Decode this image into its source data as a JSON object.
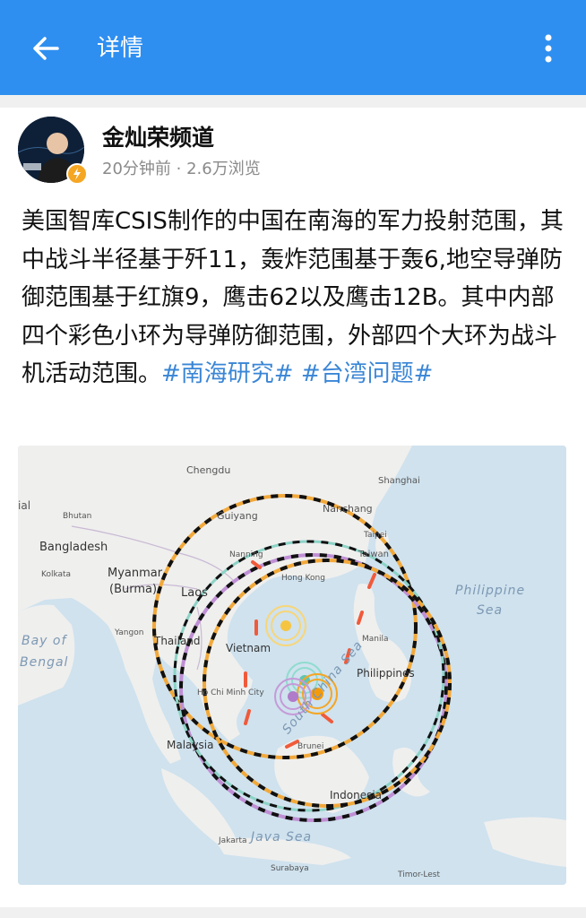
{
  "header": {
    "title": "详情",
    "icons": [
      "arrow-left-icon",
      "more-vertical-icon"
    ]
  },
  "author": {
    "name": "金灿荣频道",
    "time": "20分钟前",
    "views": "2.6万浏览",
    "meta": "20分钟前 · 2.6万浏览"
  },
  "post": {
    "text": "美国智库CSIS制作的中国在南海的军力投射范围，其中战斗半径基于歼11，轰炸范围基于轰6,地空导弹防御范围基于红旗9，鹰击62以及鹰击12B。其中内部四个彩色小环为导弹防御范围，外部四个大环为战斗机活动范围。",
    "tags": [
      "#南海研究#",
      "#台湾问题#"
    ]
  },
  "map": {
    "labels": {
      "chengdu": "Chengdu",
      "guiyang": "Guiyang",
      "nanchang": "Nanchang",
      "shanghai": "Shanghai",
      "bhutan": "Bhutan",
      "bangladesh": "Bangladesh",
      "kolkata": "Kolkata",
      "myanmar1": "Myanmar",
      "myanmar2": "(Burma)",
      "laos": "Laos",
      "nanning": "Nanning",
      "hongkong": "Hong Kong",
      "taipei": "Taipei",
      "taiwan": "Taiwan",
      "yangon": "Yangon",
      "thailand": "Thailand",
      "vietnam": "Vietnam",
      "bay1": "Bay of",
      "bay2": "Bengal",
      "hcmc": "Ho Chi Minh City",
      "manila": "Manila",
      "philippines": "Philippines",
      "philsea1": "Philippine",
      "philsea2": "Sea",
      "southchinasea": "South China Sea",
      "brunei": "Brunei",
      "malaysia": "Malaysia",
      "indonesia": "Indonesia",
      "jakarta": "Jakarta",
      "javasea": "Java Sea",
      "surabaya": "Surabaya",
      "timorleste": "Timor-Lest",
      "ial": "ial"
    }
  }
}
